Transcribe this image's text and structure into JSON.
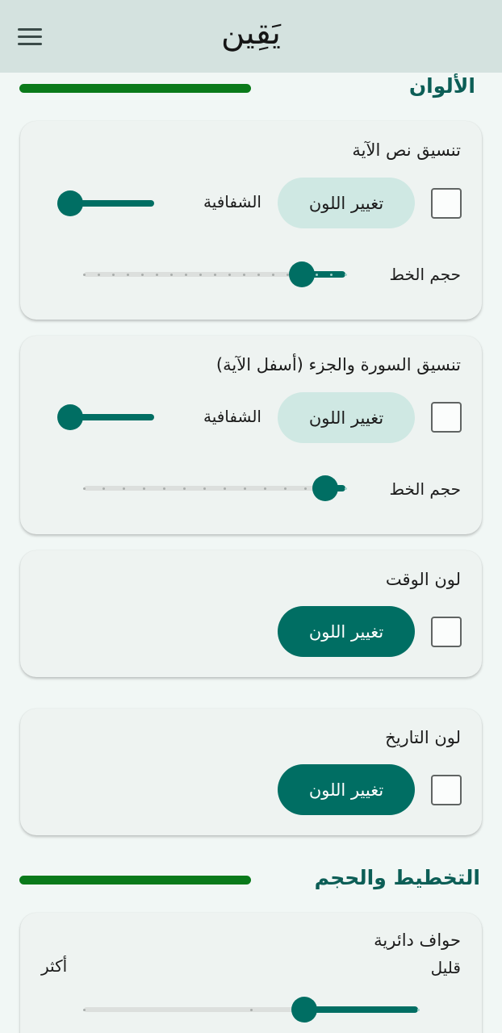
{
  "app": {
    "title": "يَقِين"
  },
  "sections": {
    "colors": {
      "title": "الألوان"
    },
    "layout": {
      "title": "التخطيط والحجم"
    }
  },
  "cards": {
    "verse_text": {
      "title": "تنسيق نص الآية",
      "change_color_label": "تغيير اللون",
      "opacity_label": "الشفافية",
      "font_size_label": "حجم الخط",
      "checked": false,
      "opacity_value": 0.0,
      "font_size_steps": 19,
      "font_size_value": 15
    },
    "surah_juz": {
      "title": "تنسيق السورة والجزء (أسفل الآية)",
      "change_color_label": "تغيير اللون",
      "opacity_label": "الشفافية",
      "font_size_label": "حجم الخط",
      "checked": false,
      "opacity_value": 0.0,
      "font_size_steps": 14,
      "font_size_value": 12
    },
    "time_color": {
      "title": "لون الوقت",
      "change_color_label": "تغيير اللون",
      "checked": false
    },
    "date_color": {
      "title": "لون التاريخ",
      "change_color_label": "تغيير اللون",
      "checked": false
    },
    "rounded_corners": {
      "title": "حواف دائرية",
      "min_label": "قليل",
      "max_label": "أكثر",
      "steps": 3,
      "value_fraction": 0.66
    }
  },
  "colors": {
    "accent": "#006e63",
    "accent_light": "#cfe8e3",
    "section_bar": "#0a7a1a",
    "section_title": "#0c5e56",
    "appbar": "#d4e2df"
  },
  "icons": {
    "menu": "hamburger-menu-icon"
  }
}
